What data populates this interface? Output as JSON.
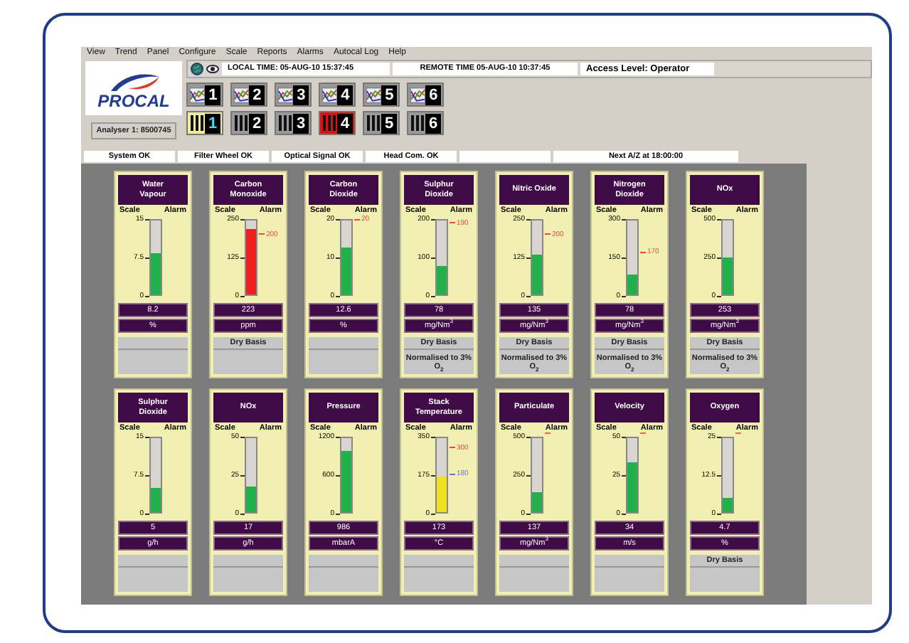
{
  "menu": [
    "View",
    "Trend",
    "Panel",
    "Configure",
    "Scale",
    "Reports",
    "Alarms",
    "Autocal Log",
    "Help"
  ],
  "logo": {
    "text": "PROCAL"
  },
  "analyser": "Analyser 1: 8500745",
  "time_bar": {
    "local_time": "LOCAL TIME:  05-AUG-10 15:37:45",
    "remote_time": "REMOTE TIME 05-AUG-10 10:37:45",
    "access_level": "Access Level: Operator"
  },
  "trend_buttons": [
    {
      "number": "1"
    },
    {
      "number": "2"
    },
    {
      "number": "3"
    },
    {
      "number": "4"
    },
    {
      "number": "5"
    },
    {
      "number": "6"
    }
  ],
  "panel_buttons": [
    {
      "number": "1",
      "selected": true,
      "alarm": false
    },
    {
      "number": "2",
      "selected": false,
      "alarm": false
    },
    {
      "number": "3",
      "selected": false,
      "alarm": false
    },
    {
      "number": "4",
      "selected": false,
      "alarm": true
    },
    {
      "number": "5",
      "selected": false,
      "alarm": false
    },
    {
      "number": "6",
      "selected": false,
      "alarm": false
    }
  ],
  "status_bar": [
    {
      "kind": "text",
      "text": "System OK"
    },
    {
      "kind": "text",
      "text": "Filter Wheel OK"
    },
    {
      "kind": "text",
      "text": "Optical Signal OK"
    },
    {
      "kind": "text",
      "text": "Head Com. OK"
    },
    {
      "kind": "blank"
    },
    {
      "kind": "text",
      "text": "Next A/Z at 18:00:00"
    }
  ],
  "gauges": [
    {
      "title": "Water Vapour",
      "scale_label": "Scale",
      "alarm_label": "Alarm",
      "scale": [
        "15",
        "7.5",
        "0"
      ],
      "level": 0.55,
      "color": "#22b04a",
      "value": "8.2",
      "unit": "%"
    },
    {
      "title": "Carbon Monoxide",
      "scale_label": "Scale",
      "alarm_label": "Alarm",
      "scale": [
        "250",
        "125",
        "0"
      ],
      "level": 0.89,
      "color": "#ee2020",
      "alarms": [
        {
          "label": "200",
          "color": "#ff4040"
        }
      ],
      "value": "223",
      "unit": "ppm",
      "notes": [
        "Dry Basis"
      ]
    },
    {
      "title": "Carbon Dioxide",
      "scale_label": "Scale",
      "alarm_label": "Alarm",
      "scale": [
        "20",
        "10",
        "0"
      ],
      "level": 0.63,
      "color": "#22b04a",
      "alarms": [
        {
          "label": "20",
          "color": "#ff4040"
        }
      ],
      "value": "12.6",
      "unit": "%"
    },
    {
      "title": "Sulphur Dioxide",
      "scale_label": "Scale",
      "alarm_label": "Alarm",
      "scale": [
        "200",
        "100",
        "0"
      ],
      "level": 0.39,
      "color": "#22b04a",
      "alarms": [
        {
          "label": "190",
          "color": "#ff4040"
        }
      ],
      "value": "78",
      "unit": "mg/Nm$^{3}$",
      "notes": [
        "Dry Basis",
        "Normalised to 3% O$_{2}$"
      ]
    },
    {
      "title": "Nitric Oxide",
      "scale_label": "Scale",
      "alarm_label": "Alarm",
      "scale": [
        "250",
        "125",
        "0"
      ],
      "level": 0.54,
      "color": "#22b04a",
      "alarms": [
        {
          "label": "200",
          "color": "#ff4040"
        }
      ],
      "value": "135",
      "unit": "mg/Nm$^{3}$",
      "notes": [
        "Dry Basis",
        "Normalised to 3% O$_{2}$"
      ]
    },
    {
      "title": "Nitrogen Dioxide",
      "scale_label": "Scale",
      "alarm_label": "Alarm",
      "scale": [
        "300",
        "150",
        "0"
      ],
      "level": 0.26,
      "color": "#22b04a",
      "alarms": [
        {
          "label": "170",
          "color": "#ff4040"
        }
      ],
      "value": "78",
      "unit": "mg/Nm$^{3}$",
      "notes": [
        "Dry Basis",
        "Normalised to 3% O$_{2}$"
      ]
    },
    {
      "title": "NOx",
      "scale_label": "Scale",
      "alarm_label": "Alarm",
      "scale": [
        "500",
        "250",
        "0"
      ],
      "level": 0.5,
      "color": "#22b04a",
      "value": "253",
      "unit": "mg/Nm$^{3}$",
      "notes": [
        "Dry Basis",
        "Normalised to 3% O$_{2}$"
      ]
    },
    {
      "title": "Sulphur Dioxide",
      "scale_label": "Scale",
      "alarm_label": "Alarm",
      "scale": [
        "15",
        "7.5",
        "0"
      ],
      "level": 0.33,
      "color": "#22b04a",
      "value": "5",
      "unit": "g/h"
    },
    {
      "title": "NOx",
      "scale_label": "Scale",
      "alarm_label": "Alarm",
      "scale": [
        "50",
        "25",
        "0"
      ],
      "level": 0.34,
      "color": "#22b04a",
      "value": "17",
      "unit": "g/h"
    },
    {
      "title": "Pressure",
      "scale_label": "Scale",
      "alarm_label": "Alarm",
      "scale": [
        "1200",
        "600",
        "0"
      ],
      "level": 0.82,
      "color": "#22b04a",
      "value": "986",
      "unit": "mbarA"
    },
    {
      "title": "Stack Temperature",
      "scale_label": "Scale",
      "alarm_label": "Alarm",
      "scale": [
        "350",
        "175",
        "0"
      ],
      "level": 0.49,
      "color": "#f0e020",
      "alarms": [
        {
          "label": "300",
          "color": "#ff4040"
        },
        {
          "label": "180",
          "color": "#6a6aff"
        }
      ],
      "value": "173",
      "unit": "°C"
    },
    {
      "title": "Particulate",
      "scale_label": "Scale",
      "alarm_label": "Alarm",
      "scale": [
        "500",
        "250",
        "0"
      ],
      "level": 0.27,
      "color": "#22b04a",
      "top_alarm_mark": true,
      "value": "137",
      "unit": "mg/Nm$^{3}$"
    },
    {
      "title": "Velocity",
      "scale_label": "Scale",
      "alarm_label": "Alarm",
      "scale": [
        "50",
        "25",
        "0"
      ],
      "level": 0.68,
      "color": "#22b04a",
      "top_alarm_mark": true,
      "value": "34",
      "unit": "m/s"
    },
    {
      "title": "Oxygen",
      "scale_label": "Scale",
      "alarm_label": "Alarm",
      "scale": [
        "25",
        "12.5",
        "0"
      ],
      "level": 0.19,
      "color": "#22b04a",
      "top_alarm_mark": true,
      "value": "4.7",
      "unit": "%",
      "notes": [
        "Dry Basis"
      ]
    }
  ]
}
